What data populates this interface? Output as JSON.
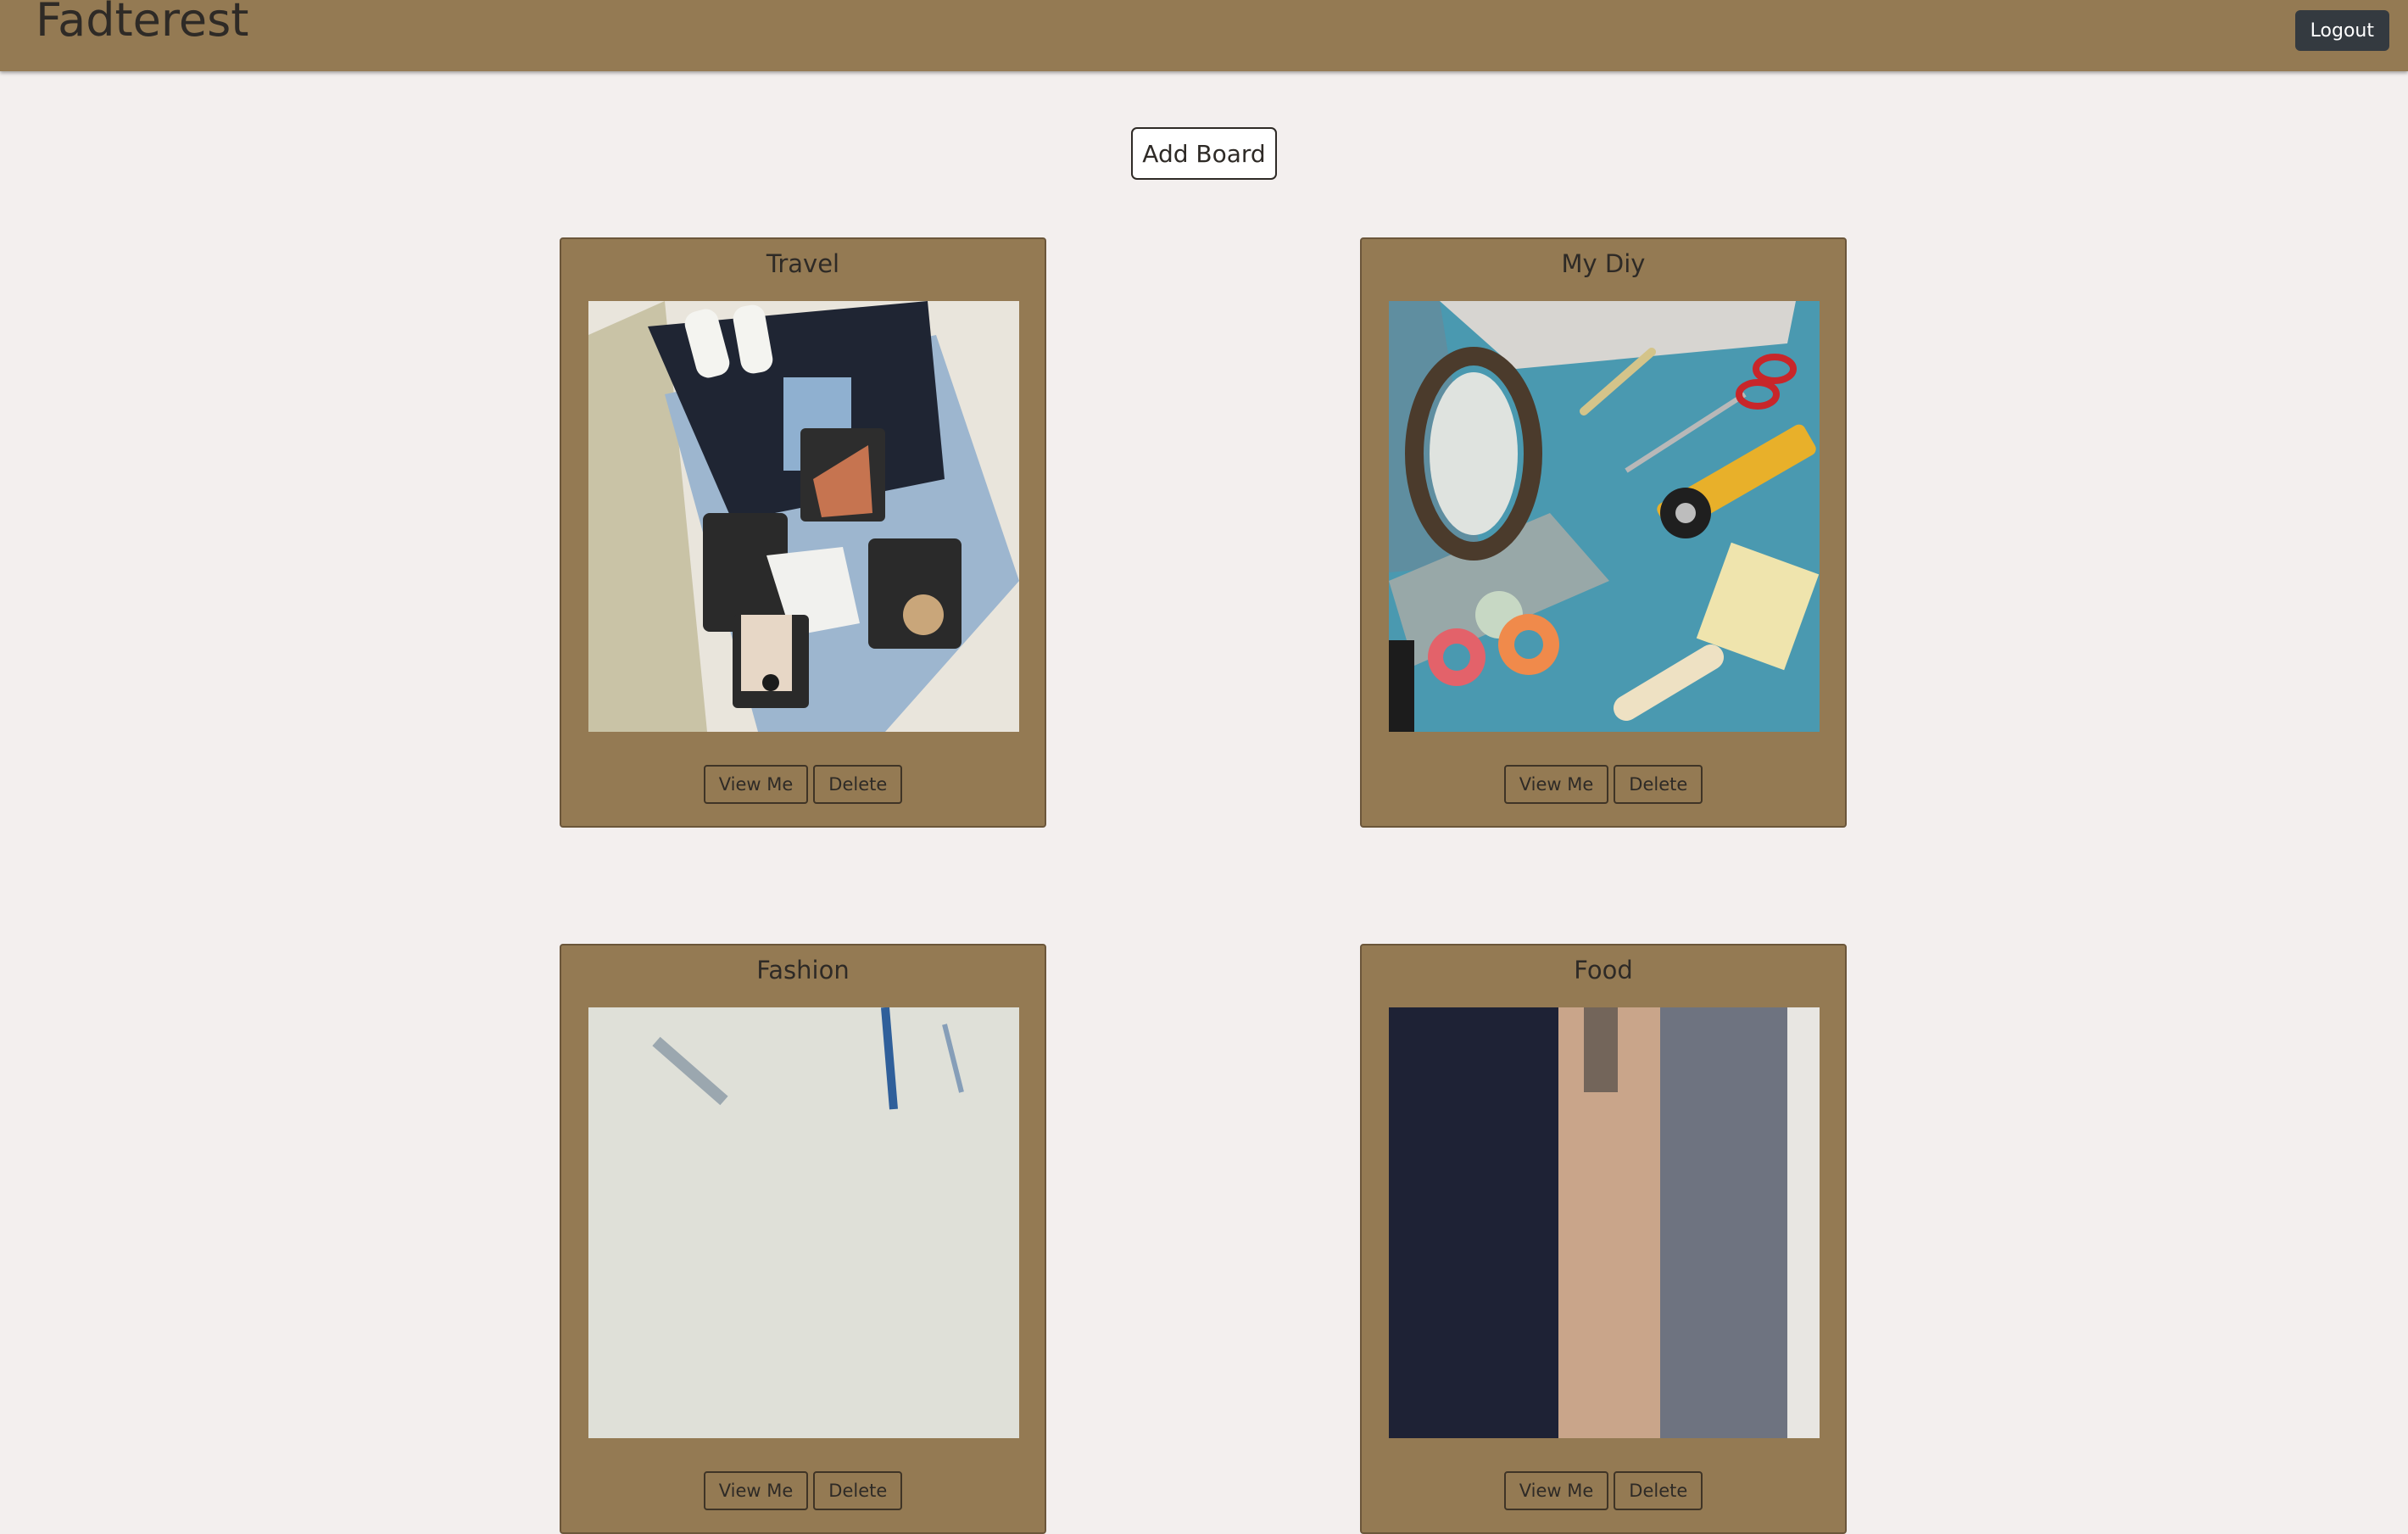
{
  "navbar": {
    "brand": "Fadterest",
    "logout_label": "Logout"
  },
  "add_board_label": "Add Board",
  "boards": [
    {
      "title": "Travel",
      "view_label": "View Me",
      "delete_label": "Delete"
    },
    {
      "title": "My Diy",
      "view_label": "View Me",
      "delete_label": "Delete"
    },
    {
      "title": "Fashion",
      "view_label": "View Me",
      "delete_label": "Delete"
    },
    {
      "title": "Food",
      "view_label": "View Me",
      "delete_label": "Delete"
    }
  ],
  "colors": {
    "navbar": "#947a53",
    "background": "#f3efee",
    "card": "#947a53",
    "logout_button": "#343a40"
  }
}
